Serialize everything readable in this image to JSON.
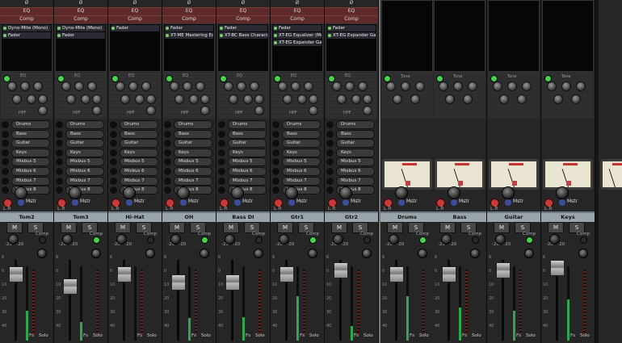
{
  "phase_symbol": "Ø",
  "eq_label": "EQ",
  "comp_label": "Comp",
  "hpf_label": "HPF",
  "tone_label": "Tone",
  "mstr_label": "Mstr",
  "lr_label": "L R",
  "mute_label": "M",
  "solo_label": "S",
  "comp_row_label": "Comp",
  "fader_scale": [
    "6",
    "0",
    "10",
    "20",
    "30",
    "40"
  ],
  "knob_scale": "-20 · -20",
  "fs_label": "Fs",
  "solo_label2": "Solo",
  "sends": [
    "Drums",
    "Bass",
    "Guitar",
    "Keys",
    "Mixbus 5",
    "Mixbus 6",
    "Mixbus 7",
    "Mixbus 8"
  ],
  "channels": [
    {
      "name": "Tom2",
      "inserts": [
        "Dyno-Mite (Mono)",
        "Fader"
      ]
    },
    {
      "name": "Tom3",
      "inserts": [
        "Dyno-Mite (Mono)",
        "Fader"
      ]
    },
    {
      "name": "Hi-Hat",
      "inserts": [
        "Fader"
      ]
    },
    {
      "name": "OH",
      "inserts": [
        "Fader",
        "XT-ME Mastering Eq"
      ]
    },
    {
      "name": "Bass DI",
      "inserts": [
        "Fader",
        "XT-BC Bass Characte"
      ]
    },
    {
      "name": "Gtr1",
      "inserts": [
        "Fader",
        "XT-EG Equalizer (Mo",
        "XT-EG Expander Gat"
      ]
    },
    {
      "name": "Gtr2",
      "inserts": [
        "Fader",
        "XT-EG Expander Gat"
      ]
    },
    {
      "name": "Drums",
      "inserts": []
    },
    {
      "name": "Bass",
      "inserts": []
    },
    {
      "name": "Guitar",
      "inserts": []
    },
    {
      "name": "Keys",
      "inserts": []
    }
  ],
  "colors": {
    "strip_bg": "#262626",
    "insert_bg": "#060606",
    "name_bar": "#9aa5ab",
    "eq_comp_bar": "#5e2a2a",
    "meter_green": "#2ea84a",
    "record_red": "#c83a3a"
  }
}
